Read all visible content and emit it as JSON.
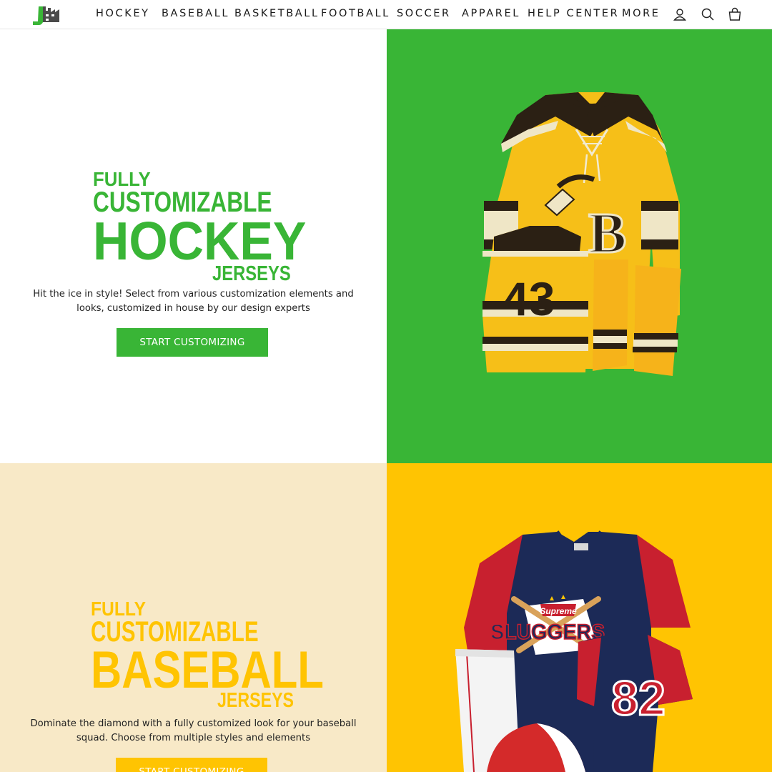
{
  "brand": {
    "logo_icon": "factory-logo-icon",
    "accent": "#39b536",
    "secondary": "#ffc402"
  },
  "nav": {
    "items": [
      {
        "label": "HOCKEY"
      },
      {
        "label": "BASEBALL"
      },
      {
        "label": "BASKETBALL"
      },
      {
        "label": "FOOTBALL"
      },
      {
        "label": "SOCCER"
      },
      {
        "label": "APPAREL"
      },
      {
        "label": "HELP CENTER"
      },
      {
        "label": "MORE"
      }
    ],
    "icons": [
      "user-icon",
      "search-icon",
      "cart-icon"
    ]
  },
  "hockey": {
    "headline": [
      "FULLY",
      "CUSTOMIZABLE",
      "HOCKEY",
      "JERSEYS"
    ],
    "description_line1": "Hit the ice in style! Select from various customization elements and",
    "description_line2": "looks, customized in house by our design experts",
    "cta": "START CUSTOMIZING",
    "jersey_number": "43",
    "crest_letter": "B",
    "bg_color": "#39b536"
  },
  "baseball": {
    "headline": [
      "FULLY",
      "CUSTOMIZABLE",
      "BASEBALL",
      "JERSEYS"
    ],
    "description_line1": "Dominate the diamond with a fully customized look for your baseball",
    "description_line2": "squad. Choose from multiple styles and elements",
    "cta": "START CUSTOMIZING",
    "crest_script": "Supreme",
    "crest_name": "SLUGGERS",
    "jersey_number": "82",
    "bg_color": "#ffc402"
  }
}
